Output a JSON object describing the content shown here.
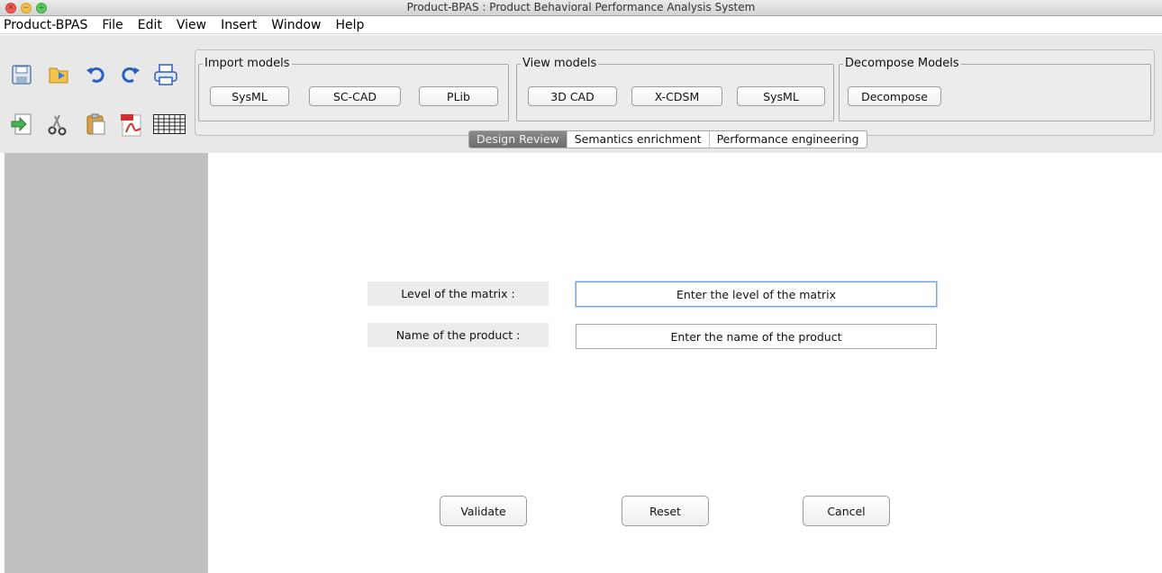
{
  "window": {
    "title": "Product-BPAS : Product Behavioral Performance Analysis System",
    "close_glyph": "✕",
    "min_glyph": "−",
    "max_glyph": "+"
  },
  "menu": [
    "Product-BPAS",
    "File",
    "Edit",
    "View",
    "Insert",
    "Window",
    "Help"
  ],
  "toolbar_icons": [
    "save-icon",
    "open-folder-icon",
    "undo-icon",
    "redo-icon",
    "print-icon",
    "import-icon",
    "cut-icon",
    "paste-icon",
    "pdf-icon",
    "table-icon"
  ],
  "groups": {
    "import": {
      "title": "Import models",
      "buttons": [
        "SysML",
        "SC-CAD",
        "PLib"
      ]
    },
    "view": {
      "title": "View models",
      "buttons": [
        "3D CAD",
        "X-CDSM",
        "SysML"
      ]
    },
    "decompose": {
      "title": "Decompose Models",
      "buttons": [
        "Decompose"
      ]
    }
  },
  "tabs": [
    {
      "label": "Design Review",
      "active": true
    },
    {
      "label": "Semantics enrichment",
      "active": false
    },
    {
      "label": "Performance engineering",
      "active": false
    }
  ],
  "form": {
    "level_label": "Level of the matrix :",
    "level_value": "Enter the level of the matrix",
    "name_label": "Name of the product :",
    "name_value": "Enter the name of the product"
  },
  "actions": {
    "validate": "Validate",
    "reset": "Reset",
    "cancel": "Cancel"
  },
  "colors": {
    "sidebar": "#c0c0c0",
    "active_tab": "#7a7a7a",
    "focus": "#7aa7d6"
  }
}
